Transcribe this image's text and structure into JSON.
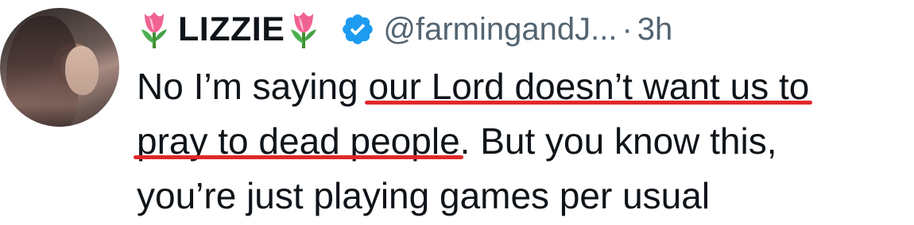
{
  "tweet": {
    "author": {
      "name": "LIZZIE",
      "handle": "@farmingandJ...",
      "avatar_icon": "avatar-photo",
      "decoration_icon": "tulip-emoji",
      "verified_icon": "verified-badge-icon",
      "verified_color": "#1d9bf0"
    },
    "separator": "·",
    "time": "3h",
    "text": {
      "line1_plain": "No I’m saying ",
      "line1_highlight": "our Lord doesn’t want us to",
      "line2_highlight": "pray to dead people",
      "line2_plain": ". But you know this,",
      "line3_plain": "you’re just playing games per usual"
    },
    "highlight_color": "#e0282a"
  }
}
